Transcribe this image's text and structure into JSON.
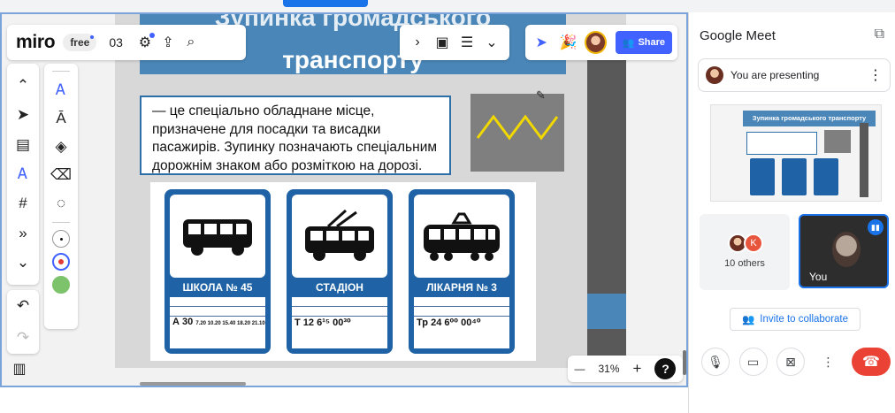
{
  "miro": {
    "logo": "miro",
    "plan_badge": "free",
    "board_number": "03",
    "share_label": "Share",
    "zoom_level": "31%",
    "help_label": "?"
  },
  "board": {
    "title_line1": "Зупинка громадського",
    "title_line2": "транспорту",
    "description": "— це спеціально обладнане місце, призначене для посадки та висадки пасажирів. Зупинку позначають спеціальним дорожнім знаком або розміткою на дорозі.",
    "signs": [
      {
        "name": "ШКОЛА № 45",
        "route": "А 30",
        "times": "7.20 10.20 15.40 18.20 21.10"
      },
      {
        "name": "СТАДІОН",
        "route": "Т 12",
        "times": "6¹⁵ 00³⁰"
      },
      {
        "name": "ЛІКАРНЯ № 3",
        "route": "Тр 24",
        "times": "6⁰⁰ 00⁴⁰"
      }
    ]
  },
  "meet": {
    "title": "Google Meet",
    "presenting": "You are presenting",
    "thumb_title": "Зупинка громадського транспорту",
    "others_initial": "K",
    "others_count": "10 others",
    "you_label": "You",
    "invite_label": "Invite to collaborate"
  },
  "colors": {
    "miro_accent": "#4262ff",
    "board_blue": "#4a86b8",
    "sign_blue": "#1f63a6",
    "meet_end": "#ea4335",
    "zigzag": "#f0d800"
  }
}
